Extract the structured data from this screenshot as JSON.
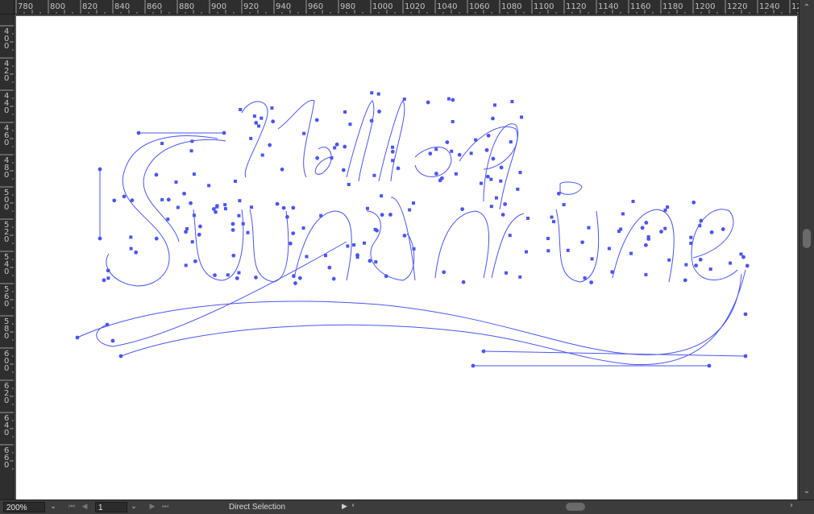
{
  "ruler": {
    "horizontal_labels": [
      "780",
      "800",
      "820",
      "840",
      "860",
      "880",
      "900",
      "920",
      "940",
      "960",
      "980",
      "1000",
      "1020",
      "1040",
      "1060",
      "1080",
      "1100",
      "1120",
      "1140",
      "1160",
      "1180",
      "1200",
      "1220",
      "1240",
      "12"
    ],
    "vertical_labels": [
      "400",
      "420",
      "440",
      "460",
      "480",
      "500",
      "520",
      "540",
      "560",
      "580",
      "600",
      "620",
      "640",
      "660"
    ]
  },
  "canvas": {
    "artwork_text": "Hello Sunshine",
    "path_color": "#4a55f0",
    "artboard_color": "#ffffff",
    "pasteboard_color": "#535353"
  },
  "statusbar": {
    "zoom": "200%",
    "page": "1",
    "tool": "Direct Selection"
  },
  "icons": {
    "zoom_dropdown": "chevron-down-icon",
    "page_dropdown": "chevron-down-icon",
    "first": "first-page-icon",
    "prev": "prev-page-icon",
    "next": "next-page-icon",
    "last": "last-page-icon",
    "status_menu": "play-arrow-icon"
  }
}
